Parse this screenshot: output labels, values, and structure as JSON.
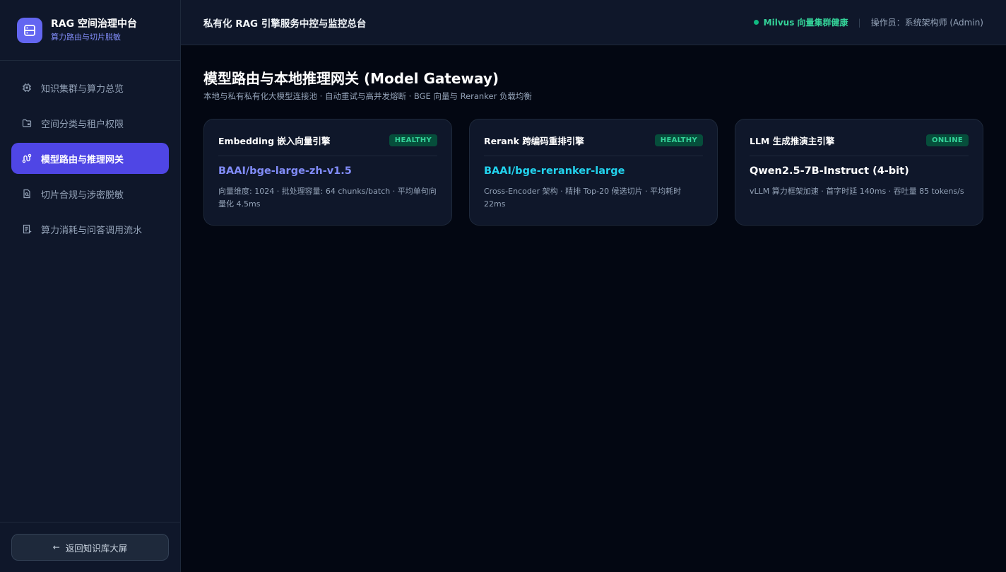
{
  "colors": {
    "accent": "#4f46e5",
    "healthy": "#34d399",
    "model_embedding": "#818cf8",
    "model_rerank": "#22d3ee",
    "model_llm": "#ffffff"
  },
  "brand": {
    "title": "RAG 空间治理中台",
    "subtitle": "算力路由与切片脱敏",
    "icon": "database-icon"
  },
  "sidebar": {
    "items": [
      {
        "label": "知识集群与算力总览",
        "icon": "cpu-icon",
        "active": false
      },
      {
        "label": "空间分类与租户权限",
        "icon": "folder-lock-icon",
        "active": false
      },
      {
        "label": "模型路由与推理网关",
        "icon": "route-icon",
        "active": true
      },
      {
        "label": "切片合规与涉密脱敏",
        "icon": "file-search-icon",
        "active": false
      },
      {
        "label": "算力消耗与问答调用流水",
        "icon": "receipt-icon",
        "active": false
      }
    ],
    "back_label": "返回知识库大屏"
  },
  "topbar": {
    "title": "私有化 RAG 引擎服务中控与监控总台",
    "status": "Milvus 向量集群健康",
    "separator": "|",
    "operator": "操作员：系统架构师 (Admin)"
  },
  "page": {
    "title": "模型路由与本地推理网关 (Model Gateway)",
    "description": "本地与私有私有化大模型连接池 · 自动重试与高并发熔断 · BGE 向量与 Reranker 负载均衡"
  },
  "cards": [
    {
      "title": "Embedding 嵌入向量引擎",
      "badge": "HEALTHY",
      "model": "BAAI/bge-large-zh-v1.5",
      "desc": "向量维度: 1024 · 批处理容量: 64 chunks/batch · 平均单句向量化 4.5ms"
    },
    {
      "title": "Rerank 跨编码重排引擎",
      "badge": "HEALTHY",
      "model": "BAAI/bge-reranker-large",
      "desc": "Cross-Encoder 架构 · 精排 Top-20 候选切片 · 平均耗时 22ms"
    },
    {
      "title": "LLM 生成推演主引擎",
      "badge": "ONLINE",
      "model": "Qwen2.5-7B-Instruct (4-bit)",
      "desc": "vLLM 算力框架加速 · 首字时延 140ms · 吞吐量 85 tokens/s"
    }
  ]
}
